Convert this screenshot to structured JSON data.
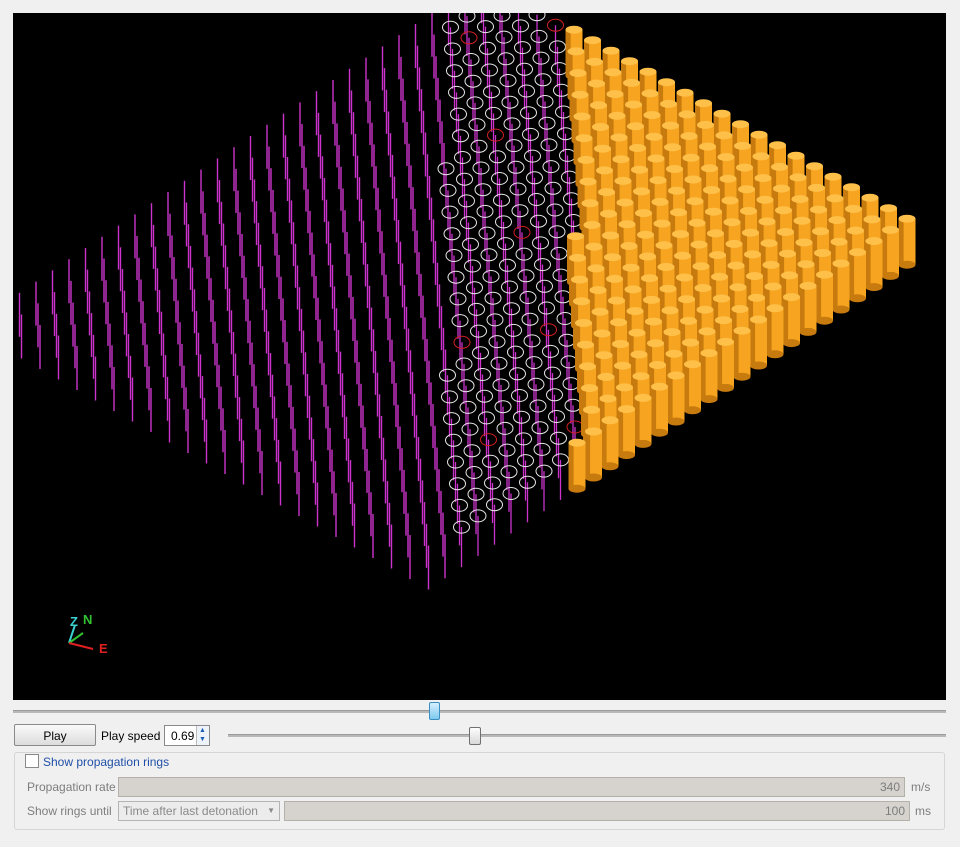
{
  "viewport": {
    "background": "#000000",
    "colors": {
      "charge": "#f7a520",
      "charge_shade": "#c77a0d",
      "hole_line": "#cc33cc",
      "ring": "#e6e6e6",
      "ring_active": "#d02020"
    },
    "axes": {
      "z_label": "Z",
      "n_label": "N",
      "e_label": "E"
    }
  },
  "timeline": {
    "position_fraction": 0.45
  },
  "controls": {
    "play_label": "Play",
    "speed_label": "Play speed",
    "speed_value": "0.69",
    "speed_slider_fraction": 0.34
  },
  "rings": {
    "show_label": "Show propagation rings",
    "show_checked": false,
    "rate_label": "Propagation rate",
    "rate_value": "340",
    "rate_unit": "m/s",
    "until_label": "Show rings until",
    "until_option": "Time after last detonation",
    "until_value": "100",
    "until_unit": "ms"
  }
}
